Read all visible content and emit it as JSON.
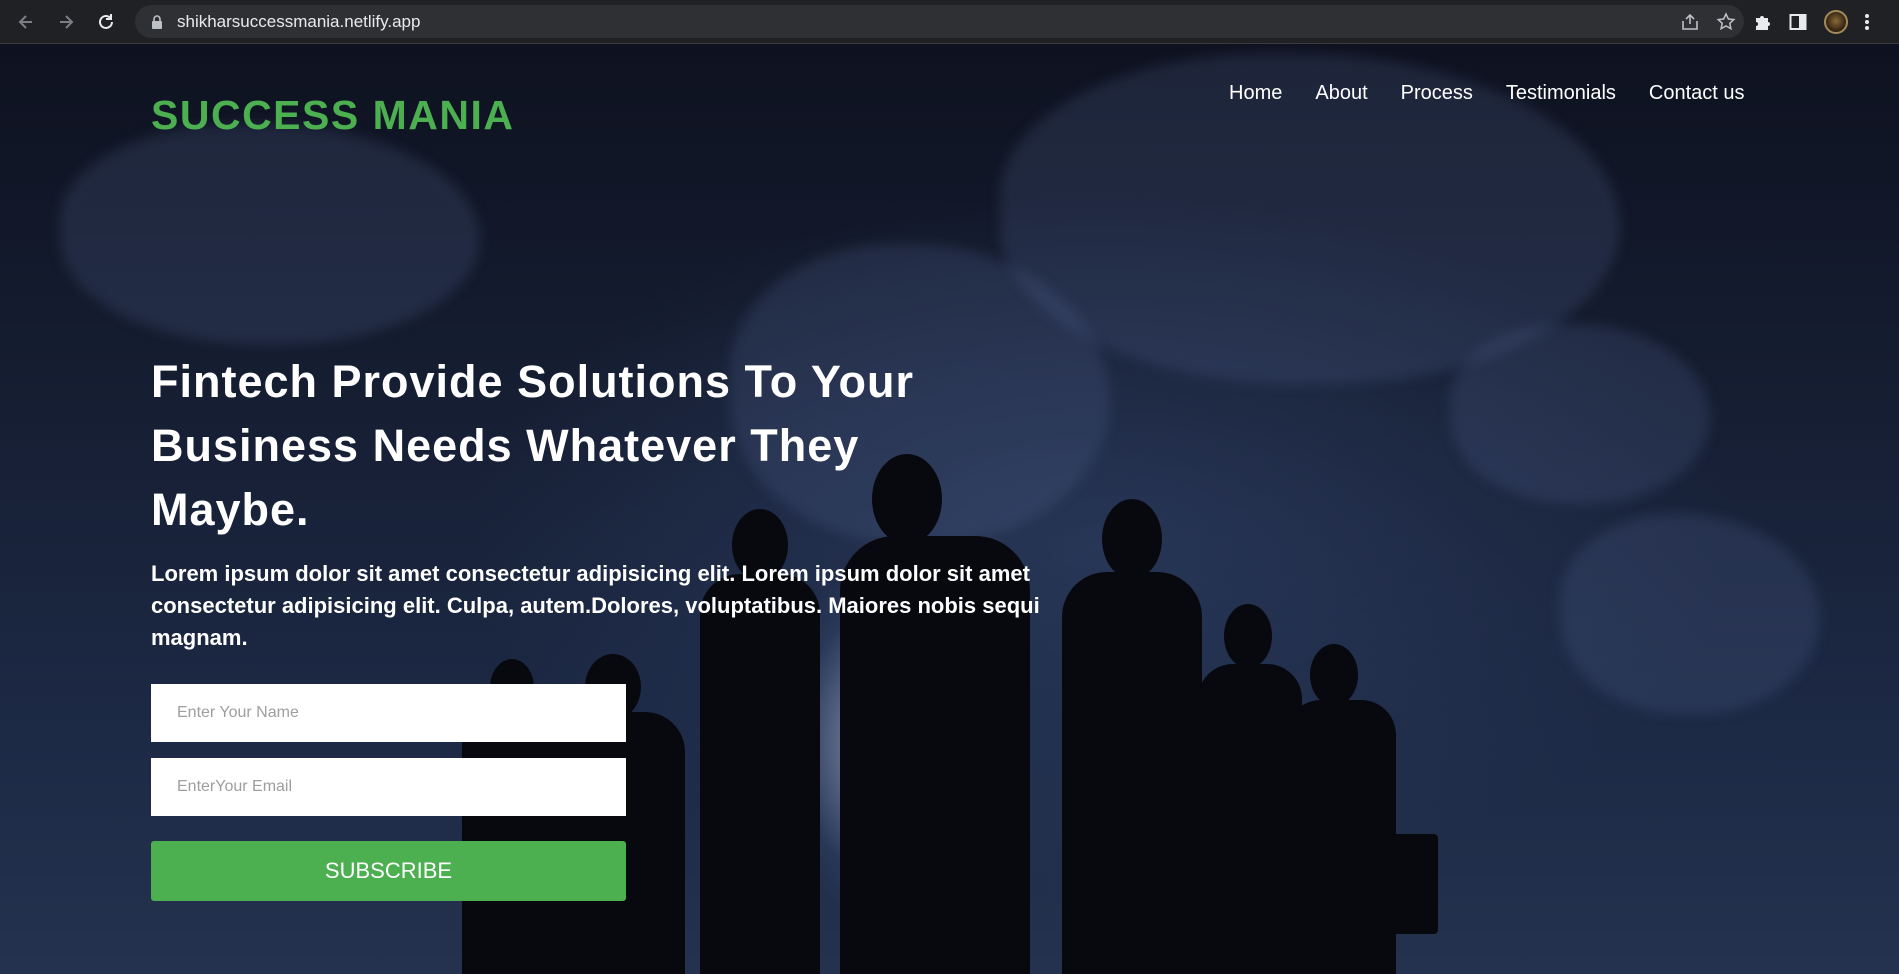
{
  "browser": {
    "url": "shikharsuccessmania.netlify.app",
    "icons": {
      "back": "arrow-left-icon",
      "forward": "arrow-right-icon",
      "reload": "reload-icon",
      "lock": "lock-icon",
      "share": "share-icon",
      "bookmark": "star-icon",
      "extensions": "puzzle-icon",
      "sidepanel": "side-panel-icon",
      "profile": "avatar",
      "menu": "kebab-menu-icon"
    }
  },
  "site": {
    "brand": "SUCCESS MANIA",
    "brand_color": "#4caf50",
    "nav": [
      {
        "label": "Home"
      },
      {
        "label": "About"
      },
      {
        "label": "Process"
      },
      {
        "label": "Testimonials"
      },
      {
        "label": "Contact us"
      }
    ],
    "hero": {
      "headline_1": "Fintech Provide Solutions To Your",
      "headline_2": "Business Needs Whatever They",
      "headline_3": "Maybe.",
      "subtext": "Lorem ipsum dolor sit amet consectetur adipisicing elit. Lorem ipsum dolor sit amet consectetur adipisicing elit. Culpa, autem.Dolores, voluptatibus. Maiores nobis sequi magnam.",
      "name_placeholder": "Enter Your Name",
      "email_placeholder": "EnterYour Email",
      "subscribe_label": "SUBSCRIBE"
    }
  }
}
